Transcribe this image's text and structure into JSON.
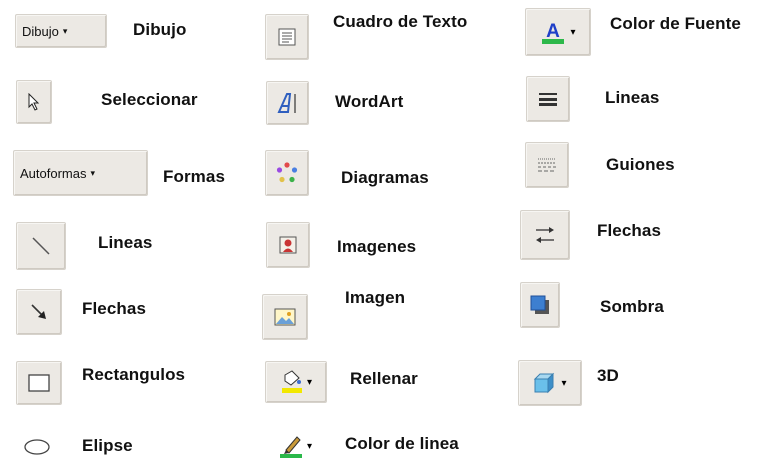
{
  "col1": {
    "dibujo_button": "Dibujo",
    "dibujo_label": "Dibujo",
    "select_label": "Seleccionar",
    "autoformas_button": "Autoformas",
    "formas_label": "Formas",
    "lineas_label": "Lineas",
    "flechas_label": "Flechas",
    "rect_label": "Rectangulos",
    "elipse_label": "Elipse"
  },
  "col2": {
    "textbox_label": "Cuadro de Texto",
    "wordart_label": "WordArt",
    "diagramas_label": "Diagramas",
    "imagenes_label": "Imagenes",
    "imagen_label": "Imagen",
    "rellenar_label": "Rellenar",
    "linecolor_label": "Color de linea"
  },
  "col3": {
    "fontcolor_label": "Color de Fuente",
    "lineas_label": "Lineas",
    "guiones_label": "Guiones",
    "flechas_label": "Flechas",
    "sombra_label": "Sombra",
    "3d_label": "3D"
  },
  "colors": {
    "fill_yellow": "#f2e800",
    "font_color_green": "#2db84a",
    "font_letter_blue": "#1f3fc8",
    "shadow_blue": "#3d7fd0"
  },
  "caret": "▾"
}
